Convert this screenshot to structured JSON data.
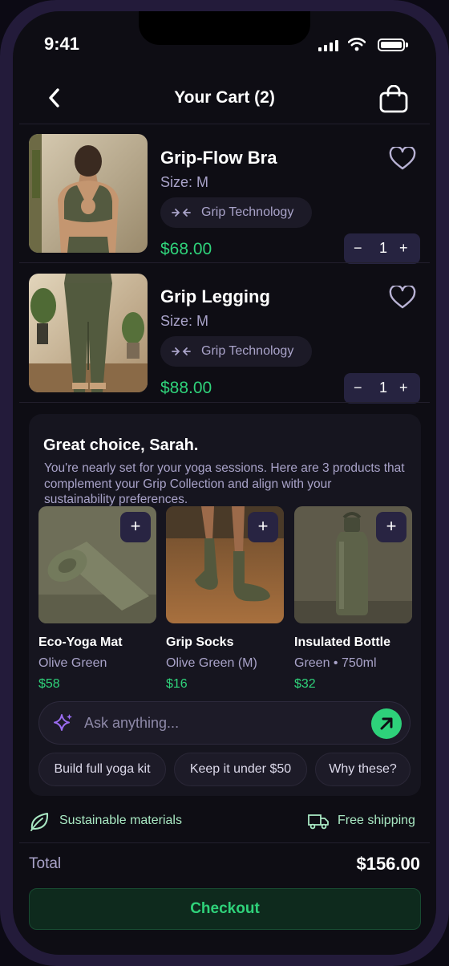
{
  "status_bar": {
    "time": "9:41"
  },
  "header": {
    "title": "Your Cart (2)"
  },
  "cart_items": [
    {
      "name": "Grip-Flow Bra",
      "size": "Size: M",
      "tag": "Grip Technology",
      "price": "$68.00",
      "quantity": "1"
    },
    {
      "name": "Grip Legging",
      "size": "Size: M",
      "tag": "Grip Technology",
      "price": "$88.00",
      "quantity": "1"
    }
  ],
  "stepper": {
    "minus": "−",
    "plus": "+"
  },
  "recommendations": {
    "title": "Great choice, Sarah.",
    "description": "You're nearly set for your yoga sessions. Here are 3 products that complement your Grip Collection and align with your sustainability preferences.",
    "products": [
      {
        "name": "Eco-Yoga Mat",
        "variant": "Olive Green",
        "price": "$58"
      },
      {
        "name": "Grip Socks",
        "variant": "Olive Green (M)",
        "price": "$16"
      },
      {
        "name": "Insulated Bottle",
        "variant": "Green • 750ml",
        "price": "$32"
      }
    ],
    "add_label": "+"
  },
  "assistant": {
    "placeholder": "Ask anything...",
    "suggestions": [
      "Build full yoga kit",
      "Keep it under $50",
      "Why these?"
    ]
  },
  "perks": {
    "materials": "Sustainable materials",
    "shipping": "Free shipping"
  },
  "summary": {
    "total_label": "Total",
    "total_value": "$156.00"
  },
  "checkout": {
    "label": "Checkout"
  },
  "colors": {
    "accent_green": "#2fd27a",
    "muted_text": "#a9a3c9",
    "background": "#0e0d14",
    "surface": "#16151f",
    "button_dark": "#262340"
  },
  "icons": [
    "back-chevron-icon",
    "shopping-bag-icon",
    "heart-icon",
    "grip-technology-icon",
    "sparkle-icon",
    "send-arrow-icon",
    "leaf-icon",
    "delivery-truck-icon"
  ]
}
